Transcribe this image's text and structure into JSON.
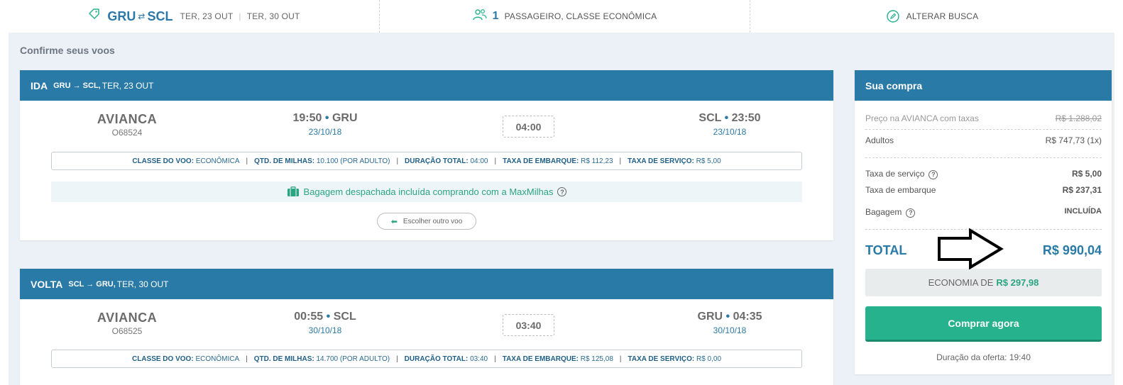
{
  "search": {
    "origin": "GRU",
    "destination": "SCL",
    "outbound_date": "TER, 23 OUT",
    "return_date": "TER, 30 OUT",
    "passengers_count": "1",
    "passengers_text": "PASSAGEIRO, CLASSE ECONÔMICA",
    "edit_label": "ALTERAR BUSCA"
  },
  "page_title": "Confirme seus voos",
  "outbound": {
    "direction": "IDA",
    "route": "GRU → SCL,",
    "date": "TER, 23 OUT",
    "airline": "AVIANCA",
    "flight_number": "O68524",
    "departure_time": "19:50",
    "departure_airport": "GRU",
    "departure_date": "23/10/18",
    "duration": "04:00",
    "arrival_airport": "SCL",
    "arrival_time": "23:50",
    "arrival_date": "23/10/18",
    "info": {
      "class_label": "CLASSE DO VOO:",
      "class_value": "ECONÔMICA",
      "miles_label": "QTD. DE MILHAS:",
      "miles_value": "10.100 (POR ADULTO)",
      "duration_label": "DURAÇÃO TOTAL:",
      "duration_value": "04:00",
      "boarding_tax_label": "TAXA DE EMBARQUE:",
      "boarding_tax_value": "R$ 112,23",
      "service_tax_label": "TAXA DE SERVIÇO:",
      "service_tax_value": "R$ 5,00"
    },
    "baggage_text": "Bagagem despachada incluída comprando com a MaxMilhas",
    "choose_other_label": "Escolher outro voo"
  },
  "return": {
    "direction": "VOLTA",
    "route": "SCL → GRU,",
    "date": "TER, 30 OUT",
    "airline": "AVIANCA",
    "flight_number": "O68525",
    "departure_time": "00:55",
    "departure_airport": "SCL",
    "departure_date": "30/10/18",
    "duration": "03:40",
    "arrival_airport": "GRU",
    "arrival_time": "04:35",
    "arrival_date": "30/10/18",
    "info": {
      "class_label": "CLASSE DO VOO:",
      "class_value": "ECONÔMICA",
      "miles_label": "QTD. DE MILHAS:",
      "miles_value": "14.700 (POR ADULTO)",
      "duration_label": "DURAÇÃO TOTAL:",
      "duration_value": "03:40",
      "boarding_tax_label": "TAXA DE EMBARQUE:",
      "boarding_tax_value": "R$ 125,08",
      "service_tax_label": "TAXA DE SERVIÇO:",
      "service_tax_value": "R$ 0,00"
    }
  },
  "summary": {
    "title": "Sua compra",
    "airline_price_label": "Preço na AVIANCA com taxas",
    "airline_price_value": "R$ 1.288,02",
    "adults_label": "Adultos",
    "adults_value": "R$ 747,73 (1x)",
    "service_tax_label": "Taxa de serviço",
    "service_tax_value": "R$ 5,00",
    "boarding_tax_label": "Taxa de embarque",
    "boarding_tax_value": "R$ 237,31",
    "baggage_label": "Bagagem",
    "baggage_value": "INCLUÍDA",
    "total_label": "TOTAL",
    "total_value": "R$ 990,04",
    "economy_label": "ECONOMIA DE",
    "economy_value": "R$ 297,98",
    "buy_label": "Comprar agora",
    "offer_duration": "Duração da oferta: 19:40"
  },
  "colors": {
    "header_blue": "#2a7aa7",
    "green": "#26b28d",
    "background": "#ebf1f6"
  }
}
